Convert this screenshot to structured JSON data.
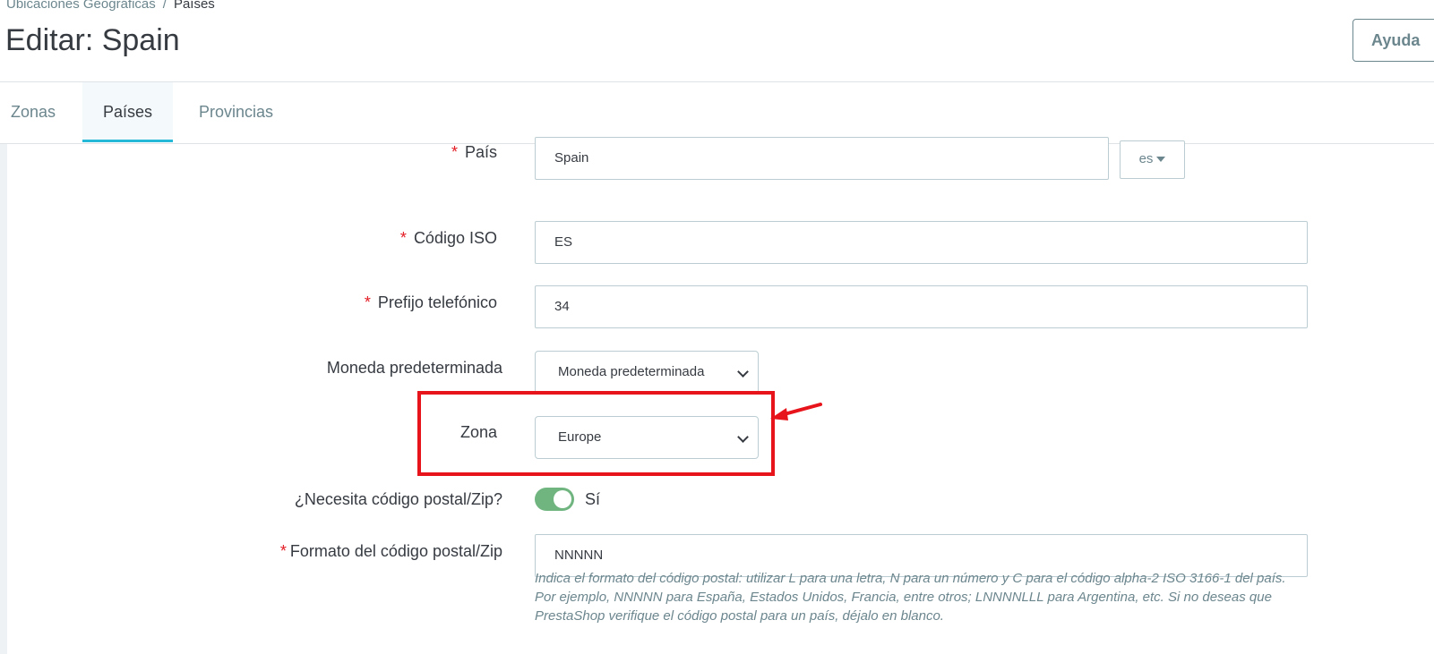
{
  "breadcrumb": {
    "parent": "Ubicaciones Geográficas",
    "separator": "/",
    "current": "Países"
  },
  "page_title": "Editar: Spain",
  "help_button": "Ayuda",
  "tabs": [
    {
      "label": "Zonas",
      "active": false
    },
    {
      "label": "Países",
      "active": true
    },
    {
      "label": "Provincias",
      "active": false
    }
  ],
  "form": {
    "required_mark": "*",
    "country": {
      "label": "País",
      "value": "Spain",
      "lang": "es"
    },
    "iso_code": {
      "label": "Código ISO",
      "value": "ES"
    },
    "call_prefix": {
      "label": "Prefijo telefónico",
      "value": "34"
    },
    "default_currency": {
      "label": "Moneda predeterminada",
      "value": "Moneda predeterminada"
    },
    "zone": {
      "label": "Zona",
      "value": "Europe"
    },
    "need_zip": {
      "label": "¿Necesita código postal/Zip?",
      "value": "Sí",
      "enabled": true
    },
    "zip_format": {
      "label": "Formato del código postal/Zip",
      "value": "NNNNN",
      "help": "Indica el formato del código postal: utilizar L para una letra, N para un número y C para el código alpha-2 ISO 3166-1 del país. Por ejemplo, NNNNN para España, Estados Unidos, Francia, entre otros; LNNNNLLL para Argentina, etc. Si no deseas que PrestaShop verifique el código postal para un país, déjalo en blanco."
    }
  },
  "colors": {
    "accent": "#25b9d7",
    "toggle_on": "#70b580",
    "annotation": "#e8141c",
    "required": "#e31b23"
  },
  "icons": {
    "lang_caret": "caret-down-icon",
    "select_chevron": "chevron-down-icon",
    "annotation_arrow": "arrow-left-icon"
  }
}
